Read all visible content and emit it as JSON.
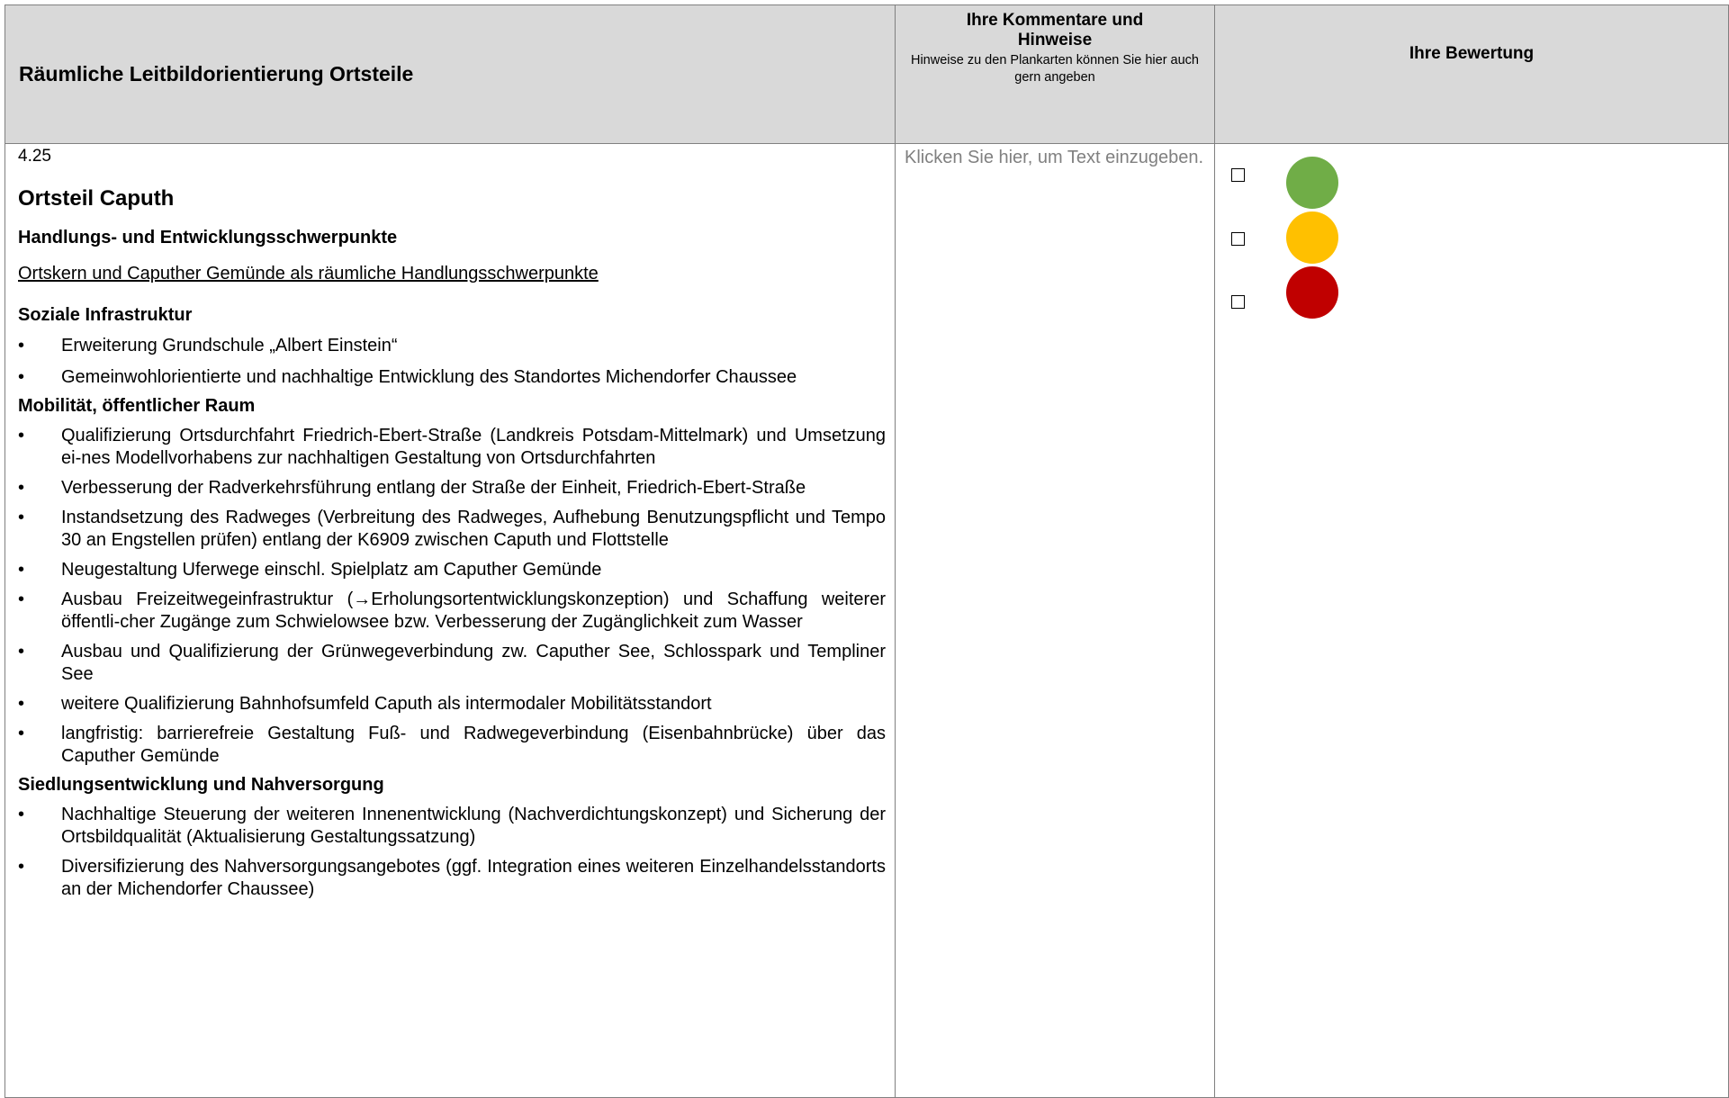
{
  "header": {
    "title": "Räumliche Leitbildorientierung Ortsteile",
    "comments_title_line1": "Ihre Kommentare und",
    "comments_title_line2": "Hinweise",
    "comments_subtitle_line1": "Hinweise zu den Plankarten können Sie hier auch",
    "comments_subtitle_line2": "gern angeben",
    "rating_title": "Ihre Bewertung"
  },
  "content": {
    "number": "4.25",
    "ortsteil": "Ortsteil Caputh",
    "focus_heading": "Handlungs- und Entwicklungsschwerpunkte",
    "focus_underlined": "Ortskern und Caputher Gemünde als räumliche Handlungsschwerpunkte",
    "sections": [
      {
        "heading": "Soziale Infrastruktur",
        "bullets": [
          "Erweiterung Grundschule „Albert Einstein“",
          "Gemeinwohlorientierte und nachhaltige Entwicklung des Standortes Michendorfer Chaussee"
        ]
      },
      {
        "heading": "Mobilität, öffentlicher Raum",
        "bullets": [
          "Qualifizierung Ortsdurchfahrt Friedrich-Ebert-Straße (Landkreis Potsdam-Mittelmark) und Umsetzung ei-nes Modellvorhabens zur nachhaltigen Gestaltung von Ortsdurchfahrten",
          "Verbesserung der Radverkehrsführung entlang der Straße der Einheit, Friedrich-Ebert-Straße",
          "Instandsetzung des Radweges (Verbreitung des Radweges, Aufhebung Benutzungspflicht und Tempo 30 an Engstellen prüfen) entlang der K6909 zwischen Caputh und Flottstelle",
          "Neugestaltung Uferwege einschl. Spielplatz am Caputher Gemünde",
          "Ausbau Freizeitwegeinfrastruktur (→Erholungsortentwicklungskonzeption) und Schaffung weiterer öffentli-cher Zugänge zum Schwielowsee bzw. Verbesserung der Zugänglichkeit zum Wasser",
          "Ausbau und  Qualifizierung der Grünwegeverbindung zw. Caputher See, Schlosspark und Templiner See",
          "weitere Qualifizierung Bahnhofsumfeld Caputh als intermodaler Mobilitätsstandort",
          "langfristig: barrierefreie Gestaltung Fuß- und Radwegeverbindung (Eisenbahnbrücke) über das Caputher Gemünde"
        ]
      },
      {
        "heading": "Siedlungsentwicklung und Nahversorgung",
        "bullets": [
          "Nachhaltige Steuerung der weiteren Innenentwicklung (Nachverdichtungskonzept) und Sicherung der Ortsbildqualität (Aktualisierung Gestaltungssatzung)",
          "Diversifizierung des Nahversorgungsangebotes (ggf. Integration eines weiteren Einzelhandelsstandorts an der Michendorfer Chaussee)"
        ]
      }
    ],
    "bullet_symbol": "•"
  },
  "comments": {
    "placeholder": "Klicken Sie hier, um Text einzugeben."
  },
  "rating": {
    "options": [
      {
        "name": "green",
        "color": "#70ad47"
      },
      {
        "name": "yellow",
        "color": "#ffc000"
      },
      {
        "name": "red",
        "color": "#c00000"
      }
    ]
  }
}
